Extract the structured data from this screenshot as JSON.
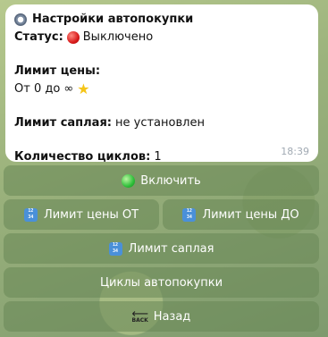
{
  "message": {
    "title": "Настройки автопокупки",
    "status_label": "Статус:",
    "status_value": "Выключено",
    "price_limit_label": "Лимит цены:",
    "price_limit_value": "От 0 до ∞",
    "spread_limit_label": "Лимит саплая:",
    "spread_limit_value": "не установлен",
    "cycles_label": "Количество циклов:",
    "cycles_value": "1",
    "time": "18:39"
  },
  "keyboard": {
    "enable": "Включить",
    "price_from": "Лимит цены ОТ",
    "price_to": "Лимит цены ДО",
    "supply_limit": "Лимит саплая",
    "cycles": "Циклы автопокупки",
    "back": "Назад",
    "back_icon_text": "BACK",
    "num_icon_top": "12",
    "num_icon_bottom": "34"
  },
  "colors": {
    "status_off": "#d81b1b",
    "enable_dot": "#2fbf3a",
    "button_bg": "rgba(104,135,86,0.55)"
  },
  "icons": {
    "title": "gear-icon",
    "status": "red-circle-icon",
    "infinity_suffix": "star-icon",
    "enable": "green-circle-icon",
    "numbers": "input-numbers-icon",
    "back": "back-arrow-icon"
  }
}
